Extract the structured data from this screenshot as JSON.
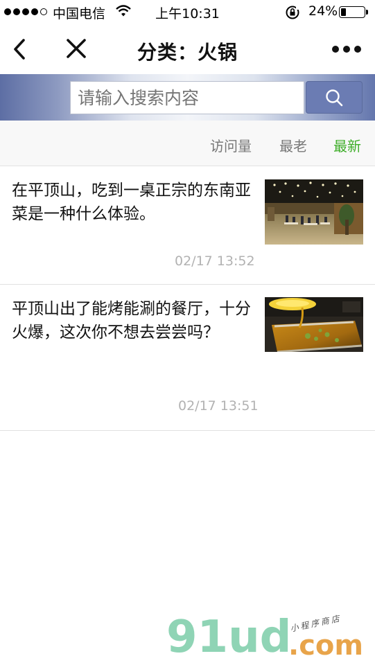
{
  "status_bar": {
    "carrier": "中国电信",
    "time": "上午10:31",
    "battery_percent": "24%",
    "battery_level": 0.24
  },
  "nav": {
    "title": "分类：火锅"
  },
  "search": {
    "placeholder": "请输入搜索内容"
  },
  "sort": {
    "views": "访问量",
    "oldest": "最老",
    "newest": "最新",
    "active": "newest",
    "active_color": "#3fae2a"
  },
  "articles": [
    {
      "title": "在平顶山，吃到一桌正宗的东南亚菜是一种什么体验。",
      "date": "02/17 13:52",
      "thumbnail": "restaurant-interior-photo"
    },
    {
      "title": "平顶山出了能烤能涮的餐厅，十分火爆，这次你不想去尝尝吗？",
      "date": "02/17 13:51",
      "thumbnail": "hotpot-soup-photo"
    }
  ],
  "watermark": {
    "logo": "91ud",
    "domain": ".com",
    "tagline": "小程序商店"
  }
}
